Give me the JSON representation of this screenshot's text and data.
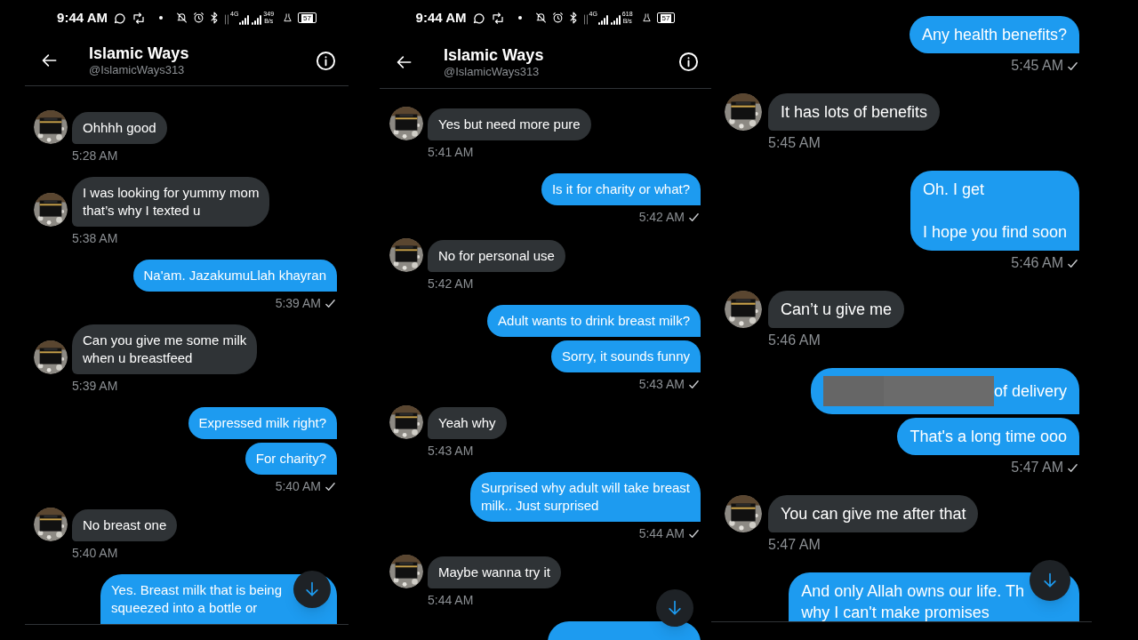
{
  "panels": [
    {
      "status_bar": {
        "time": "9:44 AM",
        "network": "4G",
        "speed": "349",
        "speed_unit": "B/s",
        "battery": "57"
      },
      "header": {
        "name": "Islamic Ways",
        "handle": "@IslamicWays313"
      },
      "messages": [
        {
          "kind": "in",
          "text": "Ohhhh good"
        },
        {
          "kind": "time_in",
          "text": "5:28 AM"
        },
        {
          "kind": "in",
          "text": "I was looking for yummy mom\nthat’s why I texted u"
        },
        {
          "kind": "time_in",
          "text": "5:38 AM"
        },
        {
          "kind": "out",
          "text": "Na'am. JazakumuLlah khayran"
        },
        {
          "kind": "time_out",
          "text": "5:39 AM",
          "check": true
        },
        {
          "kind": "in",
          "text": "Can you give me some milk\nwhen u breastfeed"
        },
        {
          "kind": "time_in",
          "text": "5:39 AM"
        },
        {
          "kind": "out",
          "text": "Expressed milk right?"
        },
        {
          "kind": "out",
          "text": "For charity?"
        },
        {
          "kind": "time_out",
          "text": "5:40 AM",
          "check": true
        },
        {
          "kind": "in",
          "text": "No breast one"
        },
        {
          "kind": "time_in",
          "text": "5:40 AM"
        },
        {
          "kind": "out",
          "text": "Yes. Breast milk that is being\nsqueezed into a bottle or"
        }
      ],
      "scroll_button": true
    },
    {
      "status_bar": {
        "time": "9:44 AM",
        "network": "4G",
        "speed": "618",
        "speed_unit": "B/s",
        "battery": "57"
      },
      "header": {
        "name": "Islamic Ways",
        "handle": "@IslamicWays313"
      },
      "messages": [
        {
          "kind": "in",
          "text": "Yes but need more pure"
        },
        {
          "kind": "time_in",
          "text": "5:41 AM"
        },
        {
          "kind": "out",
          "text": "Is it for charity or what?"
        },
        {
          "kind": "time_out",
          "text": "5:42 AM",
          "check": true
        },
        {
          "kind": "in",
          "text": "No for personal use"
        },
        {
          "kind": "time_in",
          "text": "5:42 AM"
        },
        {
          "kind": "out",
          "text": "Adult wants to drink breast milk?"
        },
        {
          "kind": "out",
          "text": "Sorry, it sounds funny"
        },
        {
          "kind": "time_out",
          "text": "5:43 AM",
          "check": true
        },
        {
          "kind": "in",
          "text": "Yeah why"
        },
        {
          "kind": "time_in",
          "text": "5:43 AM"
        },
        {
          "kind": "out",
          "text": "Surprised why adult will take breast\nmilk.. Just surprised"
        },
        {
          "kind": "time_out",
          "text": "5:44 AM",
          "check": true
        },
        {
          "kind": "in",
          "text": "Maybe wanna try it"
        },
        {
          "kind": "time_in",
          "text": "5:44 AM"
        },
        {
          "kind": "out"
        }
      ],
      "scroll_button": true
    },
    {
      "messages": [
        {
          "kind": "out",
          "text": "Any health benefits?"
        },
        {
          "kind": "time_out",
          "text": "5:45 AM",
          "check": true
        },
        {
          "kind": "in",
          "text": "It has lots of benefits"
        },
        {
          "kind": "time_in",
          "text": "5:45 AM"
        },
        {
          "kind": "out",
          "text": "Oh. I get\n\nI hope you find soon"
        },
        {
          "kind": "time_out",
          "text": "5:46 AM",
          "check": true
        },
        {
          "kind": "in",
          "text": "Can’t u give me"
        },
        {
          "kind": "time_in",
          "text": "5:46 AM"
        },
        {
          "kind": "out",
          "text": "of delivery",
          "redacted": true
        },
        {
          "kind": "out",
          "text": "That's a long time ooo"
        },
        {
          "kind": "time_out",
          "text": "5:47 AM",
          "check": true
        },
        {
          "kind": "in",
          "text": "You can give me after that"
        },
        {
          "kind": "time_in",
          "text": "5:47 AM"
        },
        {
          "kind": "out",
          "text": "And only Allah owns our life. Th\nwhy I can't make promises"
        }
      ],
      "scroll_button": true
    }
  ]
}
